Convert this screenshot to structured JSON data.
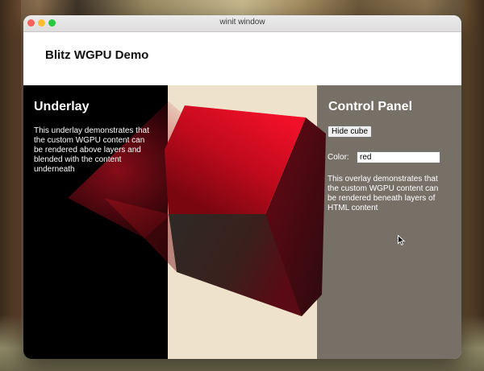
{
  "window": {
    "title": "winit window"
  },
  "header": {
    "title": "Blitz WGPU Demo"
  },
  "underlay": {
    "heading": "Underlay",
    "description": "This underlay demonstrates that the custom WGPU content can be rendered above layers and blended with the content underneath"
  },
  "control_panel": {
    "heading": "Control Panel",
    "hide_button_label": "Hide cube",
    "color_label": "Color:",
    "color_value": "red",
    "description": "This overlay demonstrates that the custom WGPU content can be rendered beneath layers of HTML content"
  },
  "colors": {
    "underlay_bg": "#000000",
    "middle_bg": "#efe2cc",
    "panel_bg": "#777067",
    "cube": "#d40a1c"
  }
}
